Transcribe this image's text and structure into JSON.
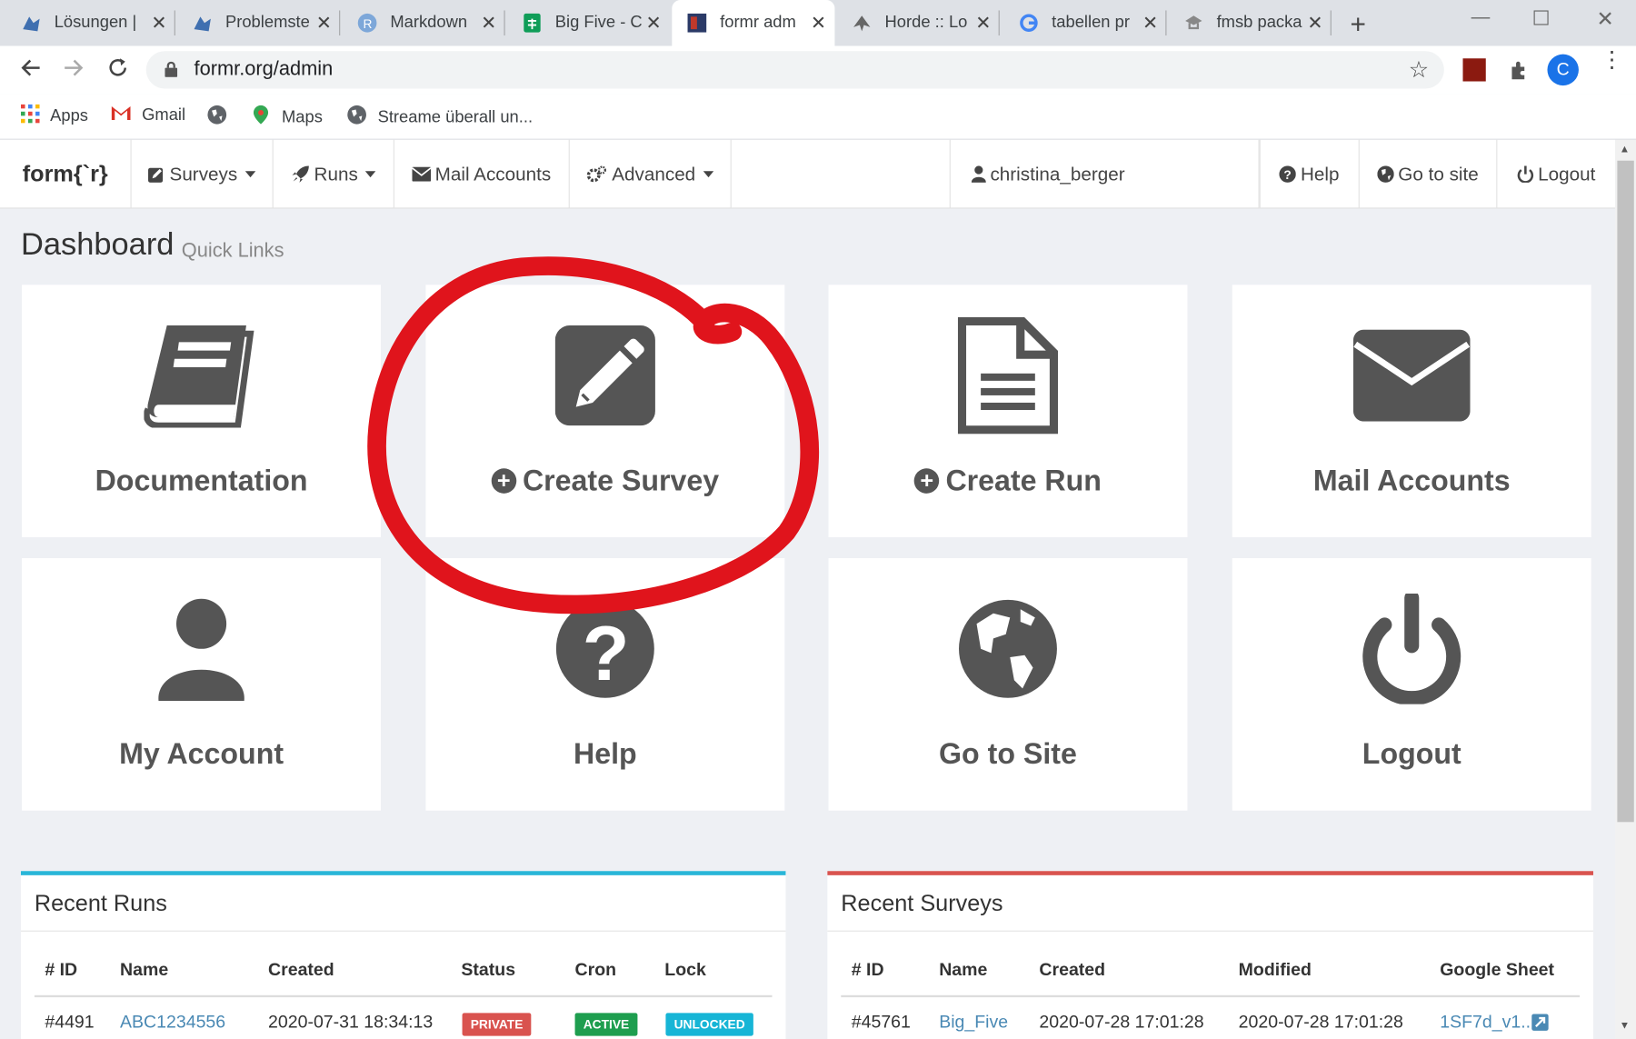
{
  "browser": {
    "tabs": [
      {
        "title": "Lösungen |"
      },
      {
        "title": "Problemste"
      },
      {
        "title": "Markdown"
      },
      {
        "title": "Big Five - C"
      },
      {
        "title": "formr adm"
      },
      {
        "title": "Horde :: Lo"
      },
      {
        "title": "tabellen pr"
      },
      {
        "title": "fmsb packa"
      }
    ],
    "url": "formr.org/admin",
    "profile_initial": "C",
    "bookmarks": [
      "Apps",
      "Gmail",
      "Maps",
      "Streame überall un..."
    ]
  },
  "nav": {
    "brand": "form{`r}",
    "surveys": "Surveys",
    "runs": "Runs",
    "mail_accounts": "Mail Accounts",
    "advanced": "Advanced",
    "user": "christina_berger",
    "help": "Help",
    "go_to_site": "Go to site",
    "logout": "Logout"
  },
  "dashboard": {
    "title": "Dashboard",
    "subtitle": "Quick Links",
    "cards": {
      "documentation": "Documentation",
      "create_survey": "Create Survey",
      "create_run": "Create Run",
      "mail_accounts": "Mail Accounts",
      "my_account": "My Account",
      "help": "Help",
      "go_to_site": "Go to Site",
      "logout": "Logout"
    }
  },
  "recent_runs": {
    "title": "Recent Runs",
    "headers": [
      "# ID",
      "Name",
      "Created",
      "Status",
      "Cron",
      "Lock"
    ],
    "row": {
      "id": "#4491",
      "name": "ABC1234556",
      "created": "2020-07-31 18:34:13",
      "status": "PRIVATE",
      "cron": "ACTIVE",
      "lock": "UNLOCKED"
    }
  },
  "recent_surveys": {
    "title": "Recent Surveys",
    "headers": [
      "# ID",
      "Name",
      "Created",
      "Modified",
      "Google Sheet"
    ],
    "row": {
      "id": "#45761",
      "name": "Big_Five",
      "created": "2020-07-28 17:01:28",
      "modified": "2020-07-28 17:01:28",
      "sheet": "1SF7d_v1..."
    }
  },
  "colors": {
    "runs_accent": "#29b6d8",
    "surveys_accent": "#d9534f",
    "badge_private": "#d9534f",
    "badge_active": "#1e9e4f",
    "badge_unlocked": "#17b5d6",
    "annotation": "#e0141c"
  }
}
